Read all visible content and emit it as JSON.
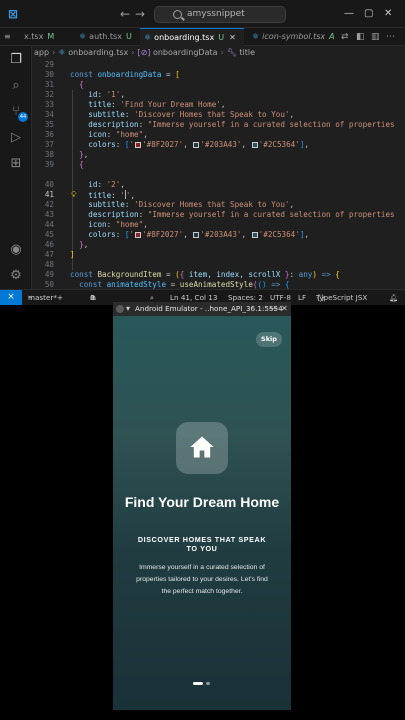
{
  "window": {
    "search_text": "amyssnippet",
    "controls": [
      "—",
      "▢",
      "✕"
    ]
  },
  "tabs": [
    {
      "label": "x.tsx",
      "badge": "M",
      "active": false
    },
    {
      "label": "auth.tsx",
      "badge": "U",
      "active": false
    },
    {
      "label": "onboarding.tsx",
      "badge": "U",
      "active": true
    },
    {
      "label": "icon-symbol.tsx",
      "badge": "A",
      "active": false
    }
  ],
  "breadcrumb": {
    "folder": "app",
    "file": "onboarding.tsx",
    "symbol": "onboardingData",
    "property": "title"
  },
  "editor": {
    "current_line": 41,
    "lines": {
      "n29": "29",
      "n30": "30",
      "n31": "31",
      "n32": "32",
      "n33": "33",
      "n34": "34",
      "n35": "35",
      "n36": "36",
      "n37": "37",
      "n38": "38",
      "n39": "39",
      "n40": "40",
      "n41": "41",
      "n42": "42",
      "n43": "43",
      "n44": "44",
      "n45": "45",
      "n46": "46",
      "n47": "47",
      "n48": "48",
      "n49": "49",
      "n50": "50"
    },
    "tokens": {
      "const": "const",
      "var_onboarding": "onboardingData",
      "eq_bracket": " = ",
      "id_key": "id",
      "id1": "'1'",
      "id2": "'2'",
      "title_key": "title",
      "title1": "'Find Your Dream Home'",
      "title2_open": "'",
      "title2_close": "'",
      "subtitle_key": "subtitle",
      "subtitle_val": "'Discover Homes that Speak to You'",
      "description_key": "description",
      "description_val": "\"Immerse yourself in a curated selection of properties",
      "icon_key": "icon",
      "icon_val": "\"home\"",
      "colors_key": "colors",
      "c1": "'#8F2027'",
      "c2": "'#203A43'",
      "c3": "'#2C5364'",
      "bg_item": "BackgroundItem",
      "bg_params": "item, index, scrollX",
      "any": "any",
      "animated_style": "animatedStyle",
      "use_animated_style": "useAnimatedStyle"
    }
  },
  "statusbar": {
    "branch": "master*+",
    "errors": "0",
    "warnings": "0",
    "position": "Ln 41, Col 13",
    "spaces": "Spaces: 2",
    "encoding": "UTF-8",
    "eol": "LF",
    "language": "TypeScript JSX"
  },
  "emulator": {
    "title": "Android Emulator - ..hone_API_36.1:5554"
  },
  "onboarding": {
    "skip": "Skip",
    "title": "Find Your Dream Home",
    "subtitle": "DISCOVER HOMES THAT SPEAK TO YOU",
    "description": "Immerse yourself in a curated selection of properties tailored to your desires. Let's find the perfect match together.",
    "icon": "home-icon",
    "page_count": 2,
    "current_page": 1
  },
  "colors": {
    "accent": "#0078d4",
    "gradient": [
      "#8F2027",
      "#203A43",
      "#2C5364"
    ]
  }
}
